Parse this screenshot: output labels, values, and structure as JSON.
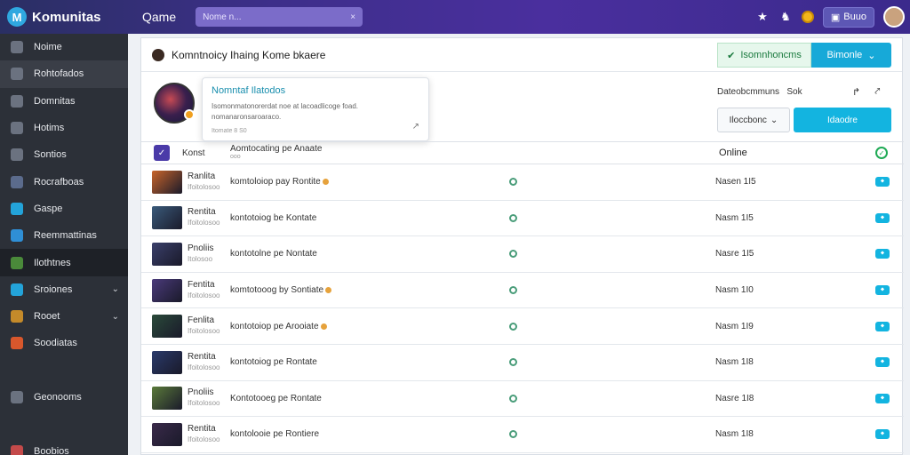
{
  "topbar": {
    "brand_logo": "M",
    "brand": "Komunitas",
    "game_title": "Qame",
    "search_value": "Nome n...",
    "search_clear": "×",
    "button_label": "Buuo",
    "icons": [
      "star-icon",
      "chess-piece-icon",
      "coin-icon",
      "user-avatar"
    ]
  },
  "sidebar": {
    "items": [
      {
        "label": "Noime",
        "icon": "home-icon",
        "color": "#6b7280"
      },
      {
        "label": "Rohtofados",
        "icon": "people-icon",
        "color": "#6b7280",
        "highlighted": true
      },
      {
        "label": "Domnitas",
        "icon": "window-icon",
        "color": "#6b7280"
      },
      {
        "label": "Hotims",
        "icon": "calendar-icon",
        "color": "#6b7280"
      },
      {
        "label": "Sontios",
        "icon": "users-icon",
        "color": "#6b7280"
      },
      {
        "label": "Rocrafboas",
        "icon": "rss-icon",
        "color": "#5b6b8c"
      },
      {
        "label": "Gaspe",
        "icon": "globe-icon",
        "color": "#23a3d9"
      },
      {
        "label": "Reemmattinas",
        "icon": "cloud-icon",
        "color": "#2f8fd6"
      },
      {
        "label": "Ilothtnes",
        "icon": "map-icon",
        "color": "#4a8a3a",
        "active": true
      },
      {
        "label": "Sroiones",
        "icon": "chat-icon",
        "color": "#23a3d9",
        "caret": "⌄"
      },
      {
        "label": "Rooet",
        "icon": "trophy-icon",
        "color": "#c48a2a",
        "caret": "⌄"
      },
      {
        "label": "Soodiatas",
        "icon": "puzzle-icon",
        "color": "#d8572c"
      },
      {
        "label": "",
        "icon": "",
        "color": "transparent"
      },
      {
        "label": "Geonooms",
        "icon": "monitor-icon",
        "color": "#6b7280"
      },
      {
        "label": "",
        "icon": "",
        "color": "transparent"
      },
      {
        "label": "Boobios",
        "icon": "tree-icon",
        "color": "#c44a4a"
      }
    ]
  },
  "header": {
    "title": "Komntnoicy Ihaing Kome bkaere",
    "btn_green": "Isomnhoncms",
    "btn_green_icon": "✔",
    "btn_teal": "Bimonle",
    "btn_teal_icon": "⌄"
  },
  "tooltip": {
    "title": "Nomntaf Ilatodos",
    "body": "Isomonmatonorerdat noe at lacoadlicoge foad. nomanaronsaroaraco.",
    "sub": "Itomate 8 S0",
    "pin": "↗"
  },
  "meta": {
    "label": "Dateobcmmuns",
    "value": "Sok",
    "icons": [
      "↱",
      "⤤"
    ]
  },
  "actions": {
    "outline_label": "Iloccbonc",
    "outline_caret": "⌄",
    "primary_label": "Idaodre"
  },
  "table": {
    "header": {
      "icon": "✓",
      "col1": "Konst",
      "col2": "Aomtocating pe Anaate",
      "col2_sub": "ooo",
      "status": "Online",
      "check": "✓"
    },
    "rows": [
      {
        "name": "Ranlita",
        "sub": "Ifoitolosoo",
        "desc": "komtoloiop pay Rontite",
        "dot": true,
        "level": "Nasen 1I5",
        "btn": "⬥",
        "thumb": "#c8642a"
      },
      {
        "name": "Rentita",
        "sub": "Ifoitolosoo",
        "desc": "kontotoiog be Kontate",
        "dot": false,
        "level": "Nasm 1I5",
        "btn": "⬥",
        "thumb": "#3a5a7a"
      },
      {
        "name": "Pnoliis",
        "sub": "Itolosoo",
        "desc": "kontotolne pe Nontate",
        "dot": false,
        "level": "Nasre 1I5",
        "btn": "⬥",
        "thumb": "#3a3f6a"
      },
      {
        "name": "Fentita",
        "sub": "Ifoitolosoo",
        "desc": "komtotooog by Sontiate",
        "dot": true,
        "level": "Nasm 1I0",
        "btn": "⬥",
        "thumb": "#4a3a7a"
      },
      {
        "name": "Fenlita",
        "sub": "Ifoitolosoo",
        "desc": "kontotoiop pe Arooiate",
        "dot": true,
        "level": "Nasm 1I9",
        "btn": "⬥",
        "thumb": "#2a4a3a"
      },
      {
        "name": "Rentita",
        "sub": "Ifoitolosoo",
        "desc": "kontotoiog pe Rontate",
        "dot": false,
        "level": "Nasm 1I8",
        "btn": "⬥",
        "thumb": "#2a3a6a"
      },
      {
        "name": "Pnoliis",
        "sub": "Ifoitolosoo",
        "desc": "Kontotooeg pe Rontate",
        "dot": false,
        "level": "Nasre 1I8",
        "btn": "⬥",
        "thumb": "#5a7a3a"
      },
      {
        "name": "Rentita",
        "sub": "Ifoitolosoo",
        "desc": "kontolooie pe Rontiere",
        "dot": false,
        "level": "Nasm 1I8",
        "btn": "⬥",
        "thumb": "#3a2a4a"
      }
    ]
  }
}
